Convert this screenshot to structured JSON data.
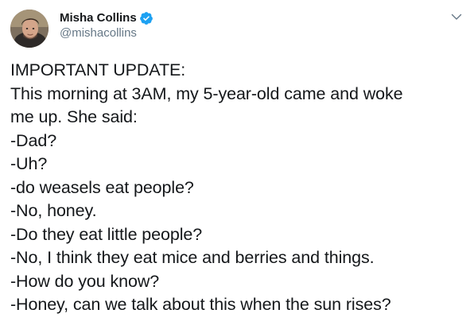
{
  "author": {
    "display_name": "Misha Collins",
    "handle": "@mishacollins",
    "verified": true,
    "avatar_icon": "profile-photo"
  },
  "icons": {
    "verified": "verified-badge-icon",
    "menu": "chevron-down-icon"
  },
  "colors": {
    "text": "#14171a",
    "secondary_text": "#657786",
    "verified_badge": "#1da1f2",
    "chevron": "#657786"
  },
  "tweet": {
    "lines": [
      "IMPORTANT UPDATE:",
      "This morning at 3AM, my 5-year-old came and woke",
      "me up. She said:",
      "-Dad?",
      "-Uh?",
      "-do weasels eat people?",
      "-No, honey.",
      "-Do they eat little people?",
      "-No, I think they eat mice and berries and things.",
      "-How do you know?",
      "-Honey, can we talk about this when the sun rises?"
    ]
  }
}
